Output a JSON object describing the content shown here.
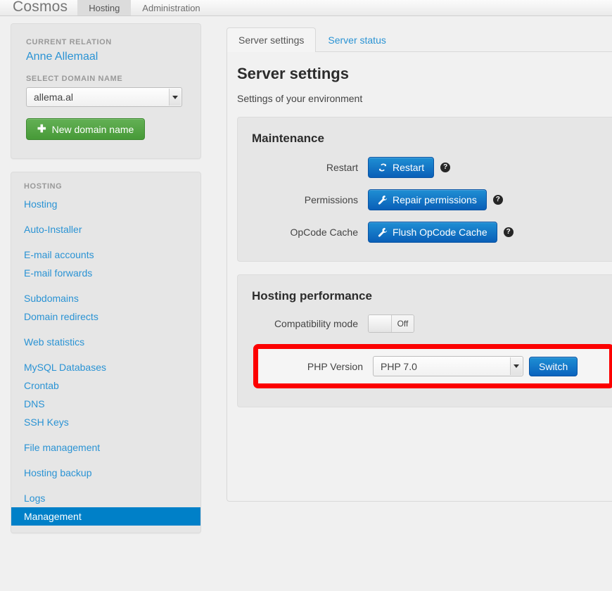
{
  "topnav": {
    "brand": "Cosmos",
    "items": [
      {
        "label": "Hosting",
        "active": true
      },
      {
        "label": "Administration",
        "active": false
      }
    ]
  },
  "sidebar": {
    "relation": {
      "caption": "CURRENT RELATION",
      "name": "Anne Allemaal",
      "domain_caption": "SELECT DOMAIN NAME",
      "domain_value": "allema.al",
      "new_domain_button": "New domain name",
      "plus_icon": "plus-icon",
      "button_color": "#4d9e3d"
    },
    "menu": {
      "caption": "HOSTING",
      "items": [
        {
          "label": "Hosting",
          "active": false,
          "gap": false
        },
        {
          "label": "Auto-Installer",
          "active": false,
          "gap": true
        },
        {
          "label": "E-mail accounts",
          "active": false,
          "gap": true
        },
        {
          "label": "E-mail forwards",
          "active": false,
          "gap": false
        },
        {
          "label": "Subdomains",
          "active": false,
          "gap": true
        },
        {
          "label": "Domain redirects",
          "active": false,
          "gap": false
        },
        {
          "label": "Web statistics",
          "active": false,
          "gap": true
        },
        {
          "label": "MySQL Databases",
          "active": false,
          "gap": true
        },
        {
          "label": "Crontab",
          "active": false,
          "gap": false
        },
        {
          "label": "DNS",
          "active": false,
          "gap": false
        },
        {
          "label": "SSH Keys",
          "active": false,
          "gap": false
        },
        {
          "label": "File management",
          "active": false,
          "gap": true
        },
        {
          "label": "Hosting backup",
          "active": false,
          "gap": true
        },
        {
          "label": "Logs",
          "active": false,
          "gap": true
        },
        {
          "label": "Management",
          "active": true,
          "gap": false
        }
      ],
      "active_color": "#0080c8",
      "link_color": "#2a93d4"
    }
  },
  "main": {
    "tabs": [
      {
        "label": "Server settings",
        "active": true
      },
      {
        "label": "Server status",
        "active": false
      }
    ],
    "title": "Server settings",
    "subtitle": "Settings of your environment",
    "maintenance": {
      "heading": "Maintenance",
      "rows": [
        {
          "label": "Restart",
          "button": "Restart",
          "icon": "refresh-icon",
          "help": "?"
        },
        {
          "label": "Permissions",
          "button": "Repair permissions",
          "icon": "wrench-icon",
          "help": "?"
        },
        {
          "label": "OpCode Cache",
          "button": "Flush OpCode Cache",
          "icon": "wrench-icon",
          "help": "?"
        }
      ]
    },
    "performance": {
      "heading": "Hosting performance",
      "compat_label": "Compatibility mode",
      "compat_value": "Off",
      "php_label": "PHP Version",
      "php_value": "PHP 7.0",
      "switch_button": "Switch",
      "highlight_color": "#fc0000"
    }
  }
}
